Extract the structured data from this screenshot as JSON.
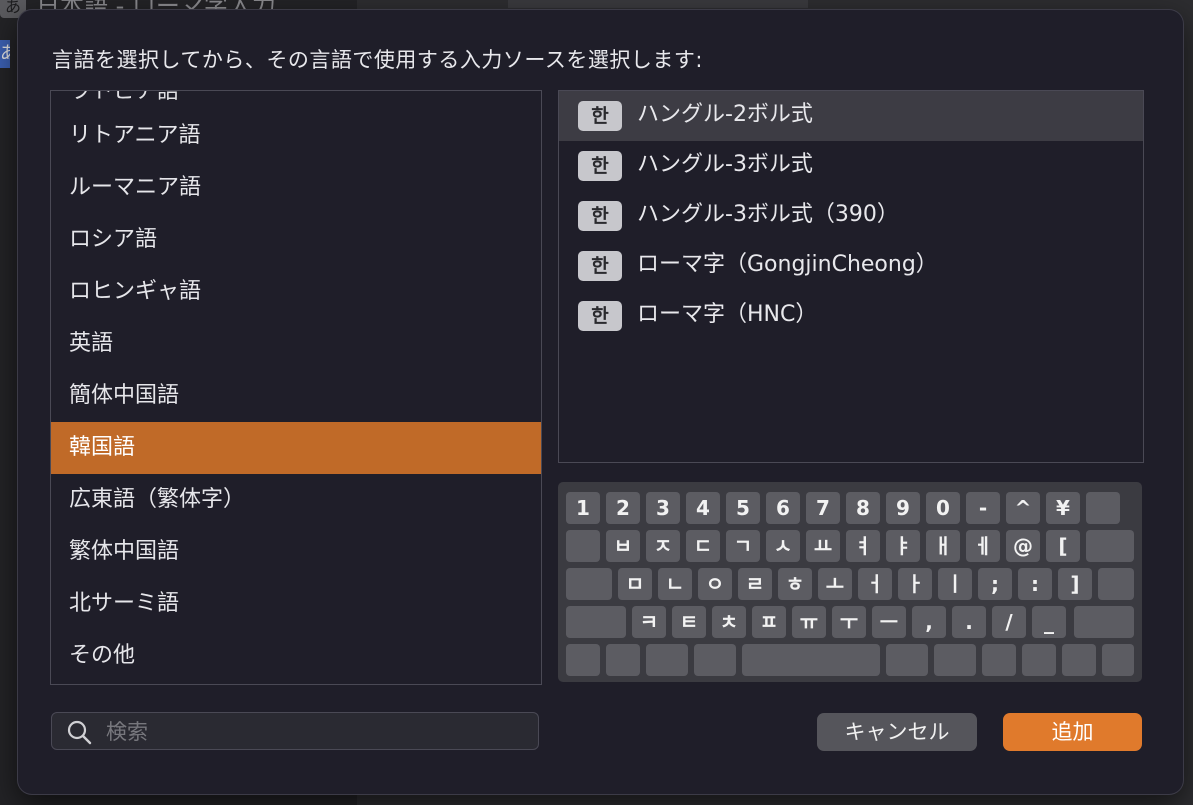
{
  "background": {
    "title": "日本語 - ローマ字入力",
    "title_icon": "あ",
    "side_icon": "あ"
  },
  "dialog": {
    "prompt": "言語を選択してから、その言語で使用する入力ソースを選択します:",
    "languages": {
      "partial_top": "ラトビア語",
      "items": [
        "リトアニア語",
        "ルーマニア語",
        "ロシア語",
        "ロヒンギャ語",
        "英語",
        "簡体中国語",
        "韓国語",
        "広東語（繁体字）",
        "繁体中国語",
        "北サーミ語",
        "その他"
      ],
      "selected": "韓国語"
    },
    "sources": {
      "badge": "한",
      "items": [
        "ハングル-2ボル式",
        "ハングル-3ボル式",
        "ハングル-3ボル式（390）",
        "ローマ字（GongjinCheong）",
        "ローマ字（HNC）"
      ],
      "selected": "ハングル-2ボル式"
    },
    "keyboard": {
      "row1": [
        "1",
        "2",
        "3",
        "4",
        "5",
        "6",
        "7",
        "8",
        "9",
        "0",
        "-",
        "^",
        "¥"
      ],
      "row2": [
        "ㅂ",
        "ㅈ",
        "ㄷ",
        "ㄱ",
        "ㅅ",
        "ㅛ",
        "ㅕ",
        "ㅑ",
        "ㅐ",
        "ㅔ",
        "@",
        "["
      ],
      "row3": [
        "ㅁ",
        "ㄴ",
        "ㅇ",
        "ㄹ",
        "ㅎ",
        "ㅗ",
        "ㅓ",
        "ㅏ",
        "ㅣ",
        ";",
        ":",
        "]"
      ],
      "row4": [
        "ㅋ",
        "ㅌ",
        "ㅊ",
        "ㅍ",
        "ㅠ",
        "ㅜ",
        "ㅡ",
        ",",
        ".",
        "/",
        "_"
      ]
    },
    "search": {
      "placeholder": "検索",
      "value": ""
    },
    "buttons": {
      "cancel": "キャンセル",
      "add": "追加"
    },
    "colors": {
      "accent": "#e07a2c",
      "selection": "#c06a28"
    }
  }
}
